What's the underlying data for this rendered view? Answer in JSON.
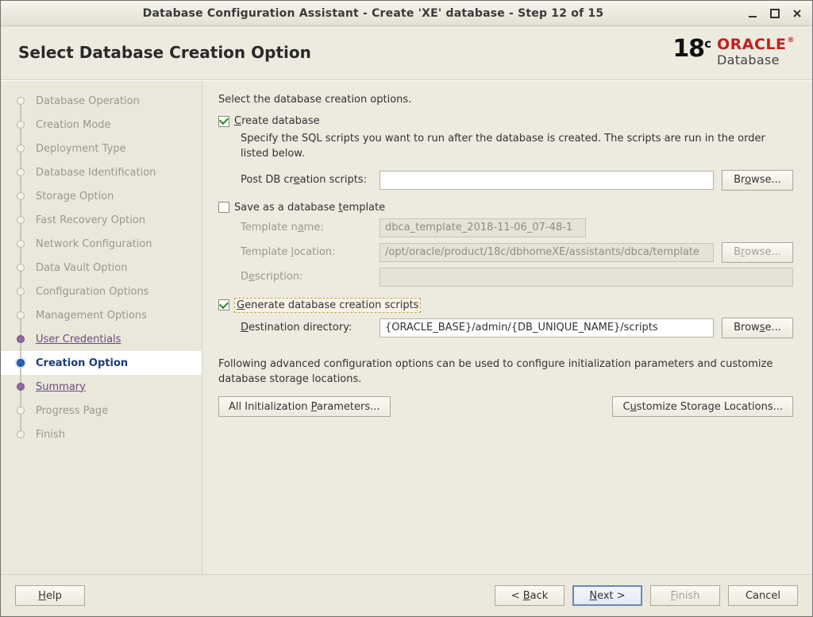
{
  "window": {
    "title": "Database Configuration Assistant - Create 'XE' database - Step 12 of 15"
  },
  "header": {
    "heading": "Select Database Creation Option",
    "brand_version": "18",
    "brand_version_suffix": "c",
    "brand_word": "ORACLE",
    "brand_subword": "Database"
  },
  "sidebar": {
    "items": [
      {
        "label": "Database Operation",
        "state": "disabled"
      },
      {
        "label": "Creation Mode",
        "state": "disabled"
      },
      {
        "label": "Deployment Type",
        "state": "disabled"
      },
      {
        "label": "Database Identification",
        "state": "disabled"
      },
      {
        "label": "Storage Option",
        "state": "disabled"
      },
      {
        "label": "Fast Recovery Option",
        "state": "disabled"
      },
      {
        "label": "Network Configuration",
        "state": "disabled"
      },
      {
        "label": "Data Vault Option",
        "state": "disabled"
      },
      {
        "label": "Configuration Options",
        "state": "disabled"
      },
      {
        "label": "Management Options",
        "state": "disabled"
      },
      {
        "label": "User Credentials",
        "state": "link"
      },
      {
        "label": "Creation Option",
        "state": "current"
      },
      {
        "label": "Summary",
        "state": "link"
      },
      {
        "label": "Progress Page",
        "state": "disabled"
      },
      {
        "label": "Finish",
        "state": "disabled"
      }
    ]
  },
  "main": {
    "intro": "Select the database creation options.",
    "create_db": {
      "checked": true,
      "label_pre": "C",
      "label_rest": "reate database",
      "desc": "Specify the SQL scripts you want to run after the database is created. The scripts are run in the order listed below.",
      "scripts_label_pre": "Post DB cr",
      "scripts_label_mn": "e",
      "scripts_label_post": "ation scripts:",
      "scripts_value": "",
      "browse_pre": "Br",
      "browse_mn": "o",
      "browse_post": "wse..."
    },
    "save_template": {
      "checked": false,
      "label_pre": "Save as a database ",
      "label_mn": "t",
      "label_post": "emplate",
      "name_label_pre": "Template n",
      "name_label_mn": "a",
      "name_label_post": "me:",
      "name_value": "dbca_template_2018-11-06_07-48-1",
      "loc_label_pre": "Template ",
      "loc_label_mn": "l",
      "loc_label_post": "ocation:",
      "loc_value": "/opt/oracle/product/18c/dbhomeXE/assistants/dbca/template",
      "desc_label_pre": "D",
      "desc_label_mn": "e",
      "desc_label_post": "scription:",
      "desc_value": "",
      "browse_pre": "B",
      "browse_mn": "r",
      "browse_post": "owse..."
    },
    "gen_scripts": {
      "checked": true,
      "label_mn": "G",
      "label_rest": "enerate database creation scripts",
      "dest_label_mn": "D",
      "dest_label_rest": "estination directory:",
      "dest_value": "{ORACLE_BASE}/admin/{DB_UNIQUE_NAME}/scripts",
      "browse_pre": "Brow",
      "browse_mn": "s",
      "browse_post": "e..."
    },
    "advanced_note": "Following advanced configuration options can be used to configure initialization parameters and customize database storage locations.",
    "init_params_btn_pre": "All Initialization ",
    "init_params_btn_mn": "P",
    "init_params_btn_post": "arameters...",
    "cust_storage_btn_pre": "C",
    "cust_storage_btn_mn": "u",
    "cust_storage_btn_post": "stomize Storage Locations..."
  },
  "footer": {
    "help_mn": "H",
    "help_rest": "elp",
    "back_pre": "< ",
    "back_mn": "B",
    "back_post": "ack",
    "next_mn": "N",
    "next_post": "ext >",
    "finish_mn": "F",
    "finish_post": "inish",
    "cancel": "Cancel"
  }
}
